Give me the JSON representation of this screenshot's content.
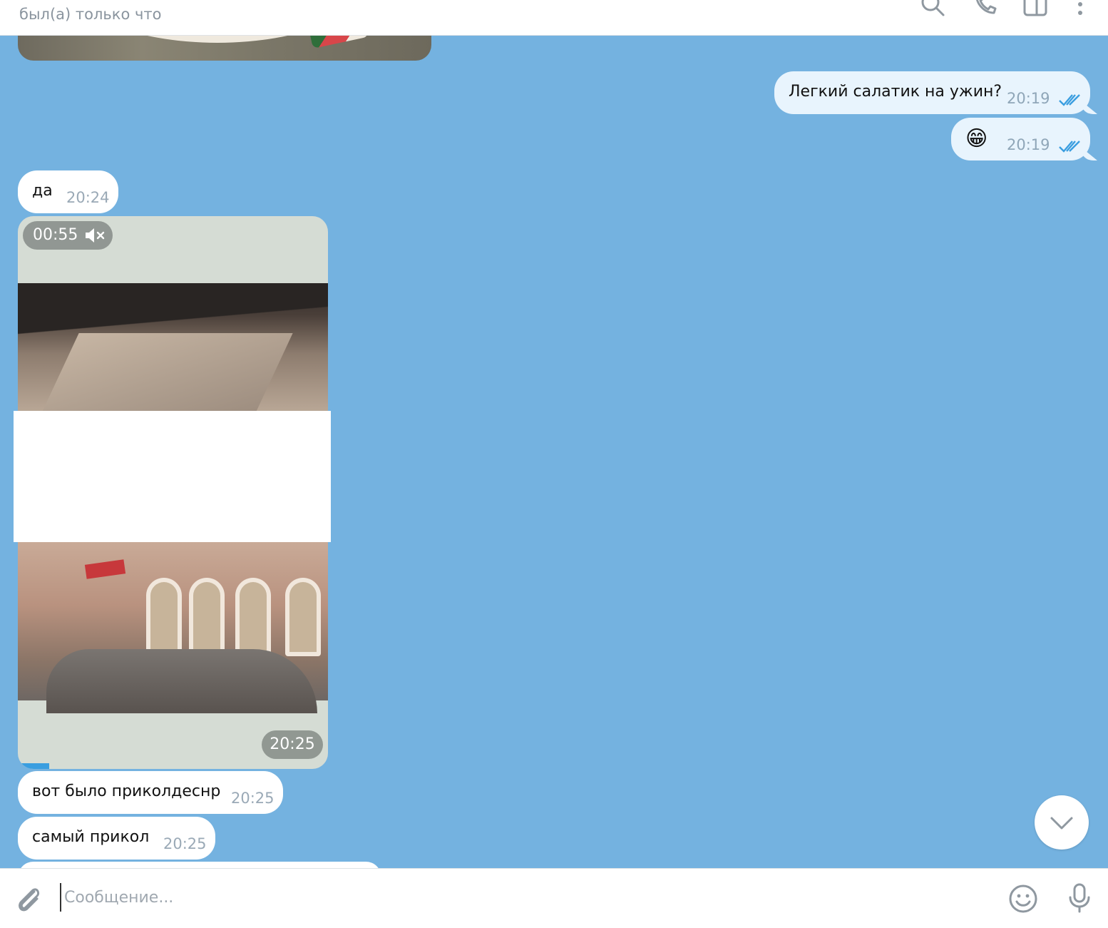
{
  "header": {
    "status": "был(а) только что",
    "icons": [
      "search-icon",
      "phone-icon",
      "sidebar-icon",
      "more-icon"
    ]
  },
  "messages": [
    {
      "direction": "out",
      "text": "Легкий салатик на ужин?",
      "time": "20:19",
      "read": true
    },
    {
      "direction": "out",
      "text": "😁",
      "time": "20:19",
      "read": true
    },
    {
      "direction": "in",
      "text": "да",
      "time": "20:24"
    },
    {
      "direction": "in",
      "type": "video",
      "duration": "00:55",
      "time": "20:25",
      "muted": true,
      "progress_fraction": 0.1
    },
    {
      "direction": "in",
      "text": "вот было приколдеснр",
      "time": "20:25"
    },
    {
      "direction": "in",
      "text": "самый прикол",
      "time": "20:25"
    }
  ],
  "composer": {
    "placeholder": "Сообщение...",
    "value": "",
    "icons": [
      "attach-icon",
      "emoji-icon",
      "microphone-icon"
    ]
  },
  "colors": {
    "chat_background": "#74b2e0",
    "outgoing_bubble": "#e8f4fd",
    "incoming_bubble": "#ffffff",
    "read_ticks": "#3a9ee0",
    "timestamp": "#9aa9b6"
  }
}
